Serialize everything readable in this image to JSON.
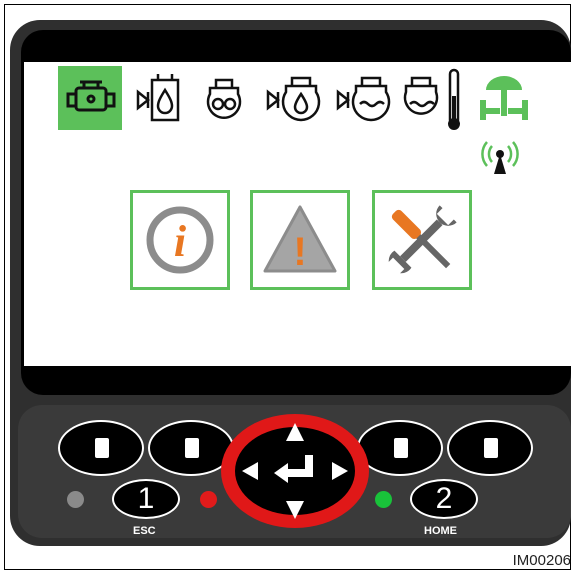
{
  "status_icons": [
    {
      "name": "engine-icon",
      "selected": true
    },
    {
      "name": "fuel-filter-icon"
    },
    {
      "name": "turbo-icon"
    },
    {
      "name": "oil-pressure-icon"
    },
    {
      "name": "coolant-level-icon"
    },
    {
      "name": "coolant-temperature-icon"
    },
    {
      "name": "generator-icon"
    },
    {
      "name": "wireless-signal-icon"
    }
  ],
  "menu": [
    {
      "name": "info-icon",
      "glyph": "i"
    },
    {
      "name": "warning-icon",
      "glyph": "!"
    },
    {
      "name": "service-tools-icon"
    }
  ],
  "keys": {
    "key1_number": "1",
    "key1_label": "ESC",
    "key2_number": "2",
    "key2_label": "HOME"
  },
  "leds": [
    {
      "name": "status-led-grey",
      "color": "#8a8a8a"
    },
    {
      "name": "status-led-red",
      "color": "#e11b1b"
    },
    {
      "name": "status-led-green",
      "color": "#19c23a"
    }
  ],
  "colors": {
    "accent_green": "#5cc05a",
    "info_orange": "#e87722",
    "highlight_ring": "#e01818"
  },
  "figure_code": "IM00206"
}
